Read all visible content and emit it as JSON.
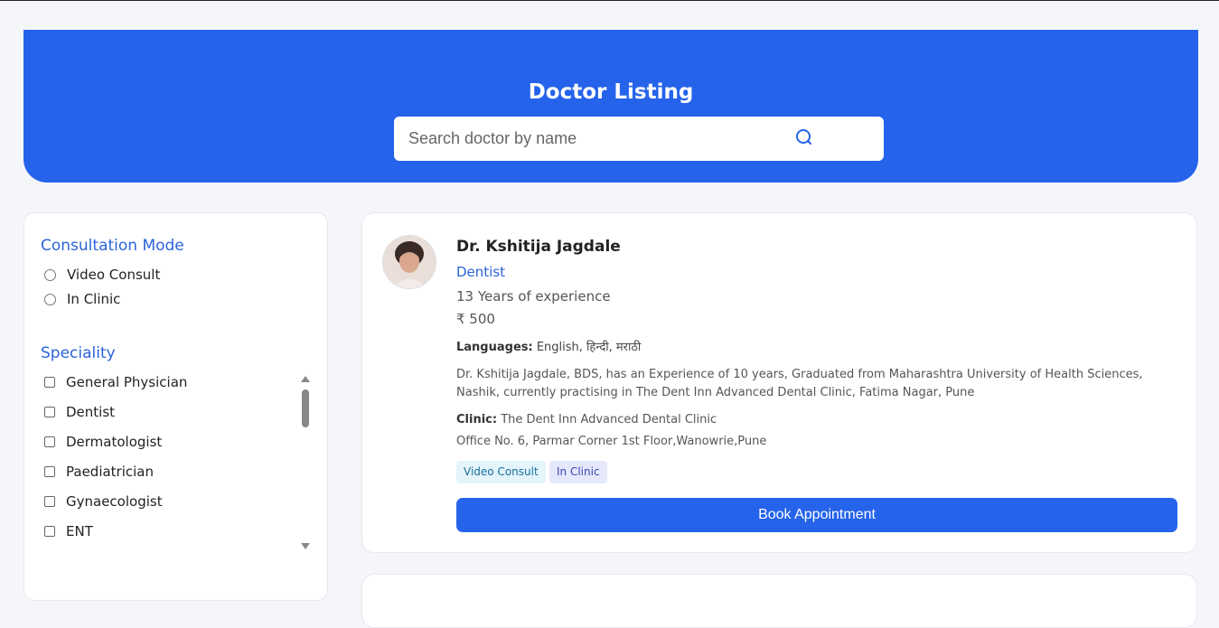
{
  "header": {
    "title": "Doctor Listing",
    "search_placeholder": "Search doctor by name"
  },
  "filters": {
    "consultation_title": "Consultation Mode",
    "consultation_options": [
      "Video Consult",
      "In Clinic"
    ],
    "speciality_title": "Speciality",
    "speciality_options": [
      "General Physician",
      "Dentist",
      "Dermatologist",
      "Paediatrician",
      "Gynaecologist",
      "ENT"
    ]
  },
  "doctors": [
    {
      "name": "Dr. Kshitija Jagdale",
      "speciality": "Dentist",
      "experience": "13 Years of experience",
      "fee": "₹ 500",
      "languages_label": "Languages:",
      "languages": "English, हिन्दी, मराठी",
      "about": "Dr. Kshitija Jagdale, BDS, has an Experience of 10 years, Graduated from Maharashtra University of Health Sciences, Nashik, currently practising in The Dent Inn Advanced Dental Clinic, Fatima Nagar, Pune",
      "clinic_label": "Clinic:",
      "clinic": "The Dent Inn Advanced Dental Clinic",
      "address": "Office No. 6, Parmar Corner 1st Floor,Wanowrie,Pune",
      "badges": [
        "Video Consult",
        "In Clinic"
      ],
      "book_label": "Book Appointment"
    }
  ],
  "colors": {
    "primary": "#2563eb",
    "accent_text": "#2b63d9",
    "background": "#f5f6fa"
  },
  "icons": {
    "search": "search-icon",
    "avatar": "doctor-avatar"
  }
}
